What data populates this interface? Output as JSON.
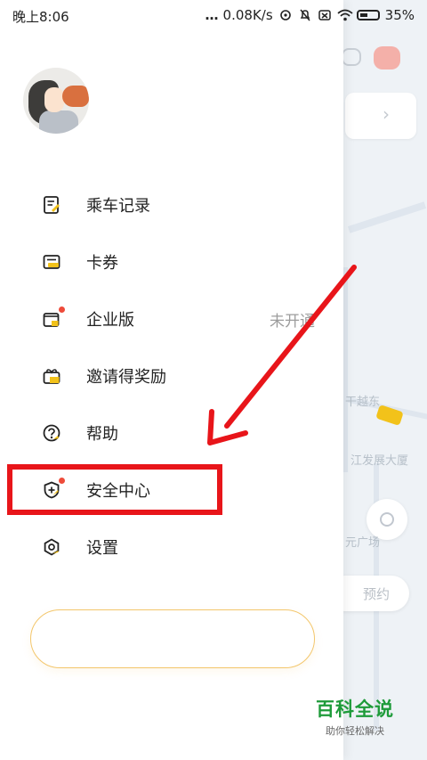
{
  "status_bar": {
    "time": "晚上8:06",
    "network_speed": "0.08K/s",
    "battery": "35%"
  },
  "map": {
    "labels": [
      "干越东",
      "江发展大厦",
      "元广场"
    ],
    "reserve_label": "预约",
    "accent_color": "#f2c21a"
  },
  "drawer": {
    "avatar_alt": "avatar",
    "menu": [
      {
        "label": "乘车记录",
        "icon": "receipt-edit-icon",
        "badge": false
      },
      {
        "label": "卡券",
        "icon": "coupon-icon",
        "badge": false
      },
      {
        "label": "企业版",
        "icon": "enterprise-folder-icon",
        "badge": true,
        "sub": "未开通"
      },
      {
        "label": "邀请得奖励",
        "icon": "gift-icon",
        "badge": false
      },
      {
        "label": "帮助",
        "icon": "help-circle-icon",
        "badge": false
      },
      {
        "label": "安全中心",
        "icon": "shield-plus-icon",
        "badge": true
      },
      {
        "label": "设置",
        "icon": "gear-icon",
        "badge": false
      }
    ],
    "icon_accent": "#f2c21a",
    "badge_color": "#ee4b3a"
  },
  "annotation": {
    "box_color": "#e8151a",
    "arrow_color": "#e8151a"
  },
  "watermark": {
    "title": "百科全说",
    "subtitle": "助你轻松解决"
  }
}
